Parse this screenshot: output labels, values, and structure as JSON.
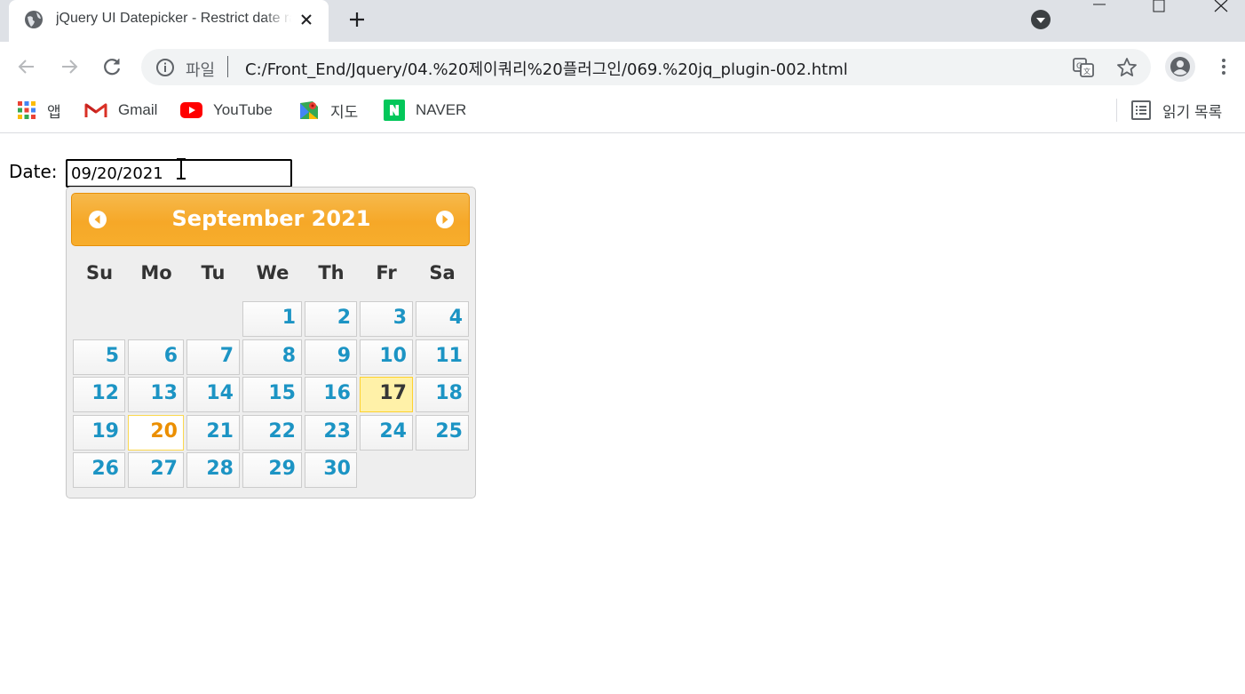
{
  "browser": {
    "tab_title": "jQuery UI Datepicker - Restrict date range",
    "address_scheme": "파일",
    "address_url": "C:/Front_End/Jquery/04.%20제이쿼리%20플러그인/069.%20jq_plugin-002.html",
    "bookmarks": [
      {
        "label": "앱",
        "icon": "apps-grid-icon"
      },
      {
        "label": "Gmail",
        "icon": "gmail-icon"
      },
      {
        "label": "YouTube",
        "icon": "youtube-icon"
      },
      {
        "label": "지도",
        "icon": "maps-icon"
      },
      {
        "label": "NAVER",
        "icon": "naver-icon"
      }
    ],
    "reading_list": "읽기 목록"
  },
  "form": {
    "label": "Date:",
    "value": "09/20/2021"
  },
  "datepicker": {
    "month_year": "September 2021",
    "weekdays": [
      "Su",
      "Mo",
      "Tu",
      "We",
      "Th",
      "Fr",
      "Sa"
    ],
    "days": [
      "1",
      "2",
      "3",
      "4",
      "5",
      "6",
      "7",
      "8",
      "9",
      "10",
      "11",
      "12",
      "13",
      "14",
      "15",
      "16",
      "17",
      "18",
      "19",
      "20",
      "21",
      "22",
      "23",
      "24",
      "25",
      "26",
      "27",
      "28",
      "29",
      "30"
    ],
    "first_weekday_index": 3,
    "today": 17,
    "selected": 20,
    "colors": {
      "header": "#f6a828",
      "day_text": "#1c94c4",
      "today_bg": "#fff1a8",
      "selected_text": "#eb8f00"
    }
  }
}
